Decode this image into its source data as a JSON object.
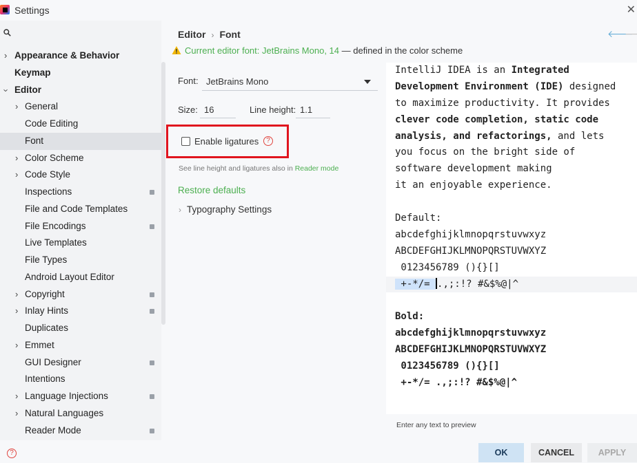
{
  "window": {
    "title": "Settings"
  },
  "sidebar": {
    "items": [
      {
        "label": "Appearance & Behavior",
        "level": 0,
        "chevron": "right"
      },
      {
        "label": "Keymap",
        "level": 0
      },
      {
        "label": "Editor",
        "level": 0,
        "chevron": "down"
      },
      {
        "label": "General",
        "level": 1,
        "chevron": "right"
      },
      {
        "label": "Code Editing",
        "level": 1
      },
      {
        "label": "Font",
        "level": 1,
        "selected": true
      },
      {
        "label": "Color Scheme",
        "level": 1,
        "chevron": "right"
      },
      {
        "label": "Code Style",
        "level": 1,
        "chevron": "right"
      },
      {
        "label": "Inspections",
        "level": 1,
        "project_icon": true
      },
      {
        "label": "File and Code Templates",
        "level": 1
      },
      {
        "label": "File Encodings",
        "level": 1,
        "project_icon": true
      },
      {
        "label": "Live Templates",
        "level": 1
      },
      {
        "label": "File Types",
        "level": 1
      },
      {
        "label": "Android Layout Editor",
        "level": 1
      },
      {
        "label": "Copyright",
        "level": 1,
        "chevron": "right",
        "project_icon": true
      },
      {
        "label": "Inlay Hints",
        "level": 1,
        "chevron": "right",
        "project_icon": true
      },
      {
        "label": "Duplicates",
        "level": 1
      },
      {
        "label": "Emmet",
        "level": 1,
        "chevron": "right"
      },
      {
        "label": "GUI Designer",
        "level": 1,
        "project_icon": true
      },
      {
        "label": "Intentions",
        "level": 1
      },
      {
        "label": "Language Injections",
        "level": 1,
        "chevron": "right",
        "project_icon": true
      },
      {
        "label": "Natural Languages",
        "level": 1,
        "chevron": "right"
      },
      {
        "label": "Reader Mode",
        "level": 1,
        "project_icon": true
      }
    ]
  },
  "header": {
    "breadcrumb": [
      "Editor",
      "Font"
    ],
    "separator": "›"
  },
  "warning": {
    "text": "Current editor font: JetBrains Mono, 14",
    "suffix": " — defined in the color scheme"
  },
  "form": {
    "font_label": "Font:",
    "font_value": "JetBrains Mono",
    "size_label": "Size:",
    "size_value": "16",
    "line_height_label": "Line height:",
    "line_height_value": "1.1",
    "ligatures_label": "Enable ligatures",
    "ligatures_checked": false,
    "note_text": "See line height and ligatures also in ",
    "note_link": "Reader mode",
    "restore_label": "Restore defaults",
    "typography_label": "Typography Settings"
  },
  "preview": {
    "lines": [
      "IntelliJ IDEA is an Integrated",
      "Development Environment (IDE) designed",
      "to maximize productivity. It provides",
      "clever code completion, static code",
      "analysis, and refactorings, and lets",
      "you focus on the bright side of",
      "software development making",
      "it an enjoyable experience.",
      "",
      "Default:",
      "abcdefghijklmnopqrstuvwxyz",
      "ABCDEFGHIJKLMNOPQRSTUVWXYZ",
      " 0123456789 (){}[]",
      "",
      "",
      "Bold:",
      "abcdefghijklmnopqrstuvwxyz",
      "ABCDEFGHIJKLMNOPQRSTUVWXYZ",
      " 0123456789 (){}[]",
      " +-*/= .,;:!? #&$%@|^"
    ],
    "caret_line_selected": " +-*/= ",
    "caret_line_rest": ".,;:!? #&$%@|^",
    "hint": "Enter any text to preview"
  },
  "buttons": {
    "ok": "OK",
    "cancel": "CANCEL",
    "apply": "APPLY"
  },
  "colors": {
    "accent_green": "#4caf50",
    "highlight_red": "#e0141e",
    "ok_bg": "#cfe3f4"
  }
}
